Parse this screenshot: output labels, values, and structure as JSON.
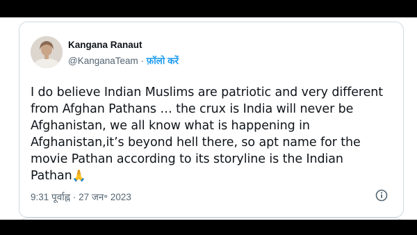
{
  "tweet": {
    "author_name": "Kangana Ranaut",
    "handle": "@KanganaTeam",
    "separator": " · ",
    "follow_label": "फ़ॉलो करें",
    "text": "I do believe Indian Muslims are patriotic and very different\nfrom Afghan Pathans … the crux is India will never be\nAfghanistan, we all know what is happening in\nAfghanistan,it’s beyond hell there, so apt name for the\nmovie Pathan according to its storyline is the Indian\nPathan",
    "emoji": "🙏",
    "timestamp": "9:31 पूर्वाह्न · 27 जन॰ 2023",
    "info_icon": "info-circle-icon"
  },
  "colors": {
    "text": "#0f1419",
    "secondary": "#536471",
    "accent": "#1d9bf0",
    "border": "#cfd9de"
  }
}
